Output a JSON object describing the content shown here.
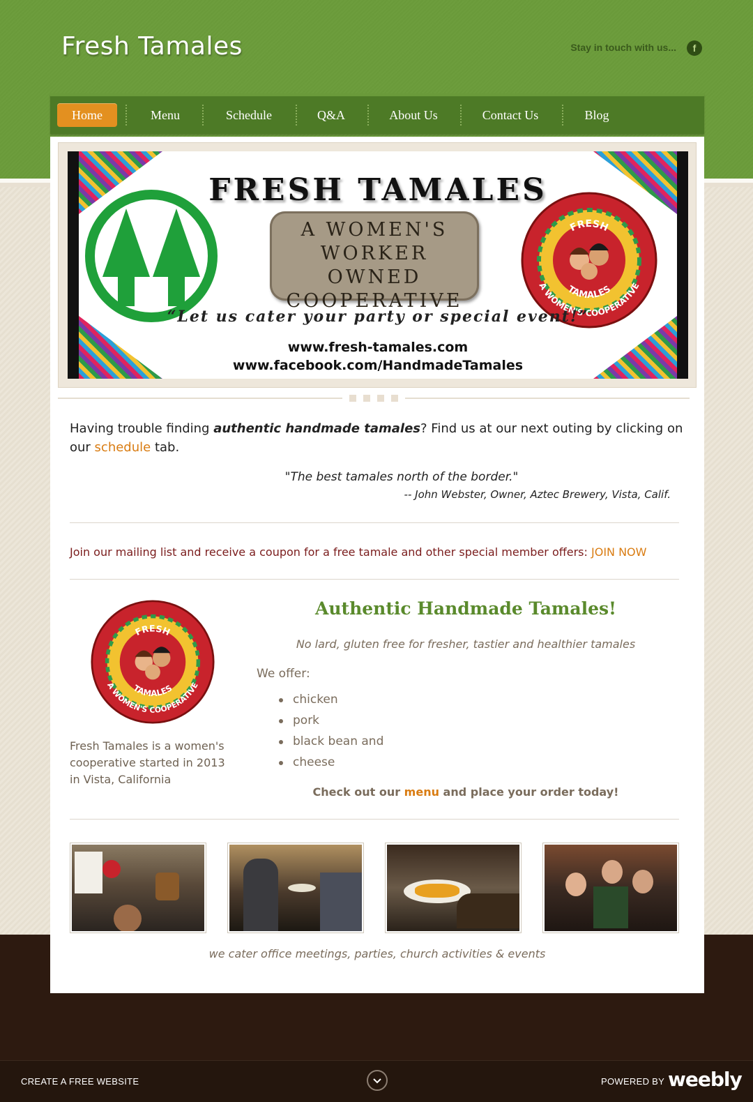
{
  "header": {
    "site_title": "Fresh Tamales",
    "social_text": "Stay in touch with us...",
    "social_icon": "facebook-icon",
    "social_glyph": "f"
  },
  "nav": {
    "items": [
      {
        "label": "Home",
        "active": true
      },
      {
        "label": "Menu"
      },
      {
        "label": "Schedule"
      },
      {
        "label": "Q&A"
      },
      {
        "label": "About Us"
      },
      {
        "label": "Contact Us"
      },
      {
        "label": "Blog"
      }
    ]
  },
  "banner": {
    "title": "FRESH TAMALES",
    "plaque_line1": "A WOMEN'S",
    "plaque_line2": "WORKER OWNED",
    "plaque_line3": "COOPERATIVE",
    "tagline": "“Let us cater your party or special event!”",
    "url1": "www.fresh-tamales.com",
    "url2": "www.facebook.com/HandmadeTamales",
    "logo_top": "FRESH",
    "logo_mid": "TAMALES",
    "logo_bottom": "A WOMEN'S COOPERATIVE"
  },
  "intro": {
    "before": "Having trouble finding ",
    "emphasis": "authentic handmade tamales",
    "middle": "?  Find us at our next outing by clicking on our ",
    "link": "schedule",
    "after": " tab."
  },
  "quote": {
    "text": "\"The best tamales north of the border.\"",
    "attribution": "-- John Webster, Owner, Aztec Brewery, Vista, Calif."
  },
  "mailing": {
    "text": "Join our mailing list and receive a coupon for a free tamale and other special member offers: ",
    "link": "JOIN NOW"
  },
  "about": {
    "description": "Fresh Tamales is a women's cooperative started in 2013 in Vista, California"
  },
  "offer": {
    "title": "Authentic Handmade Tamales!",
    "subtitle": "No lard, gluten free for fresher, tastier and healthier tamales",
    "label": "We offer:",
    "items": [
      "chicken",
      "pork",
      "black bean and",
      "cheese"
    ],
    "cta_before": "Check out our ",
    "cta_link": "menu",
    "cta_after": " and place your order today!"
  },
  "gallery": {
    "caption": "we cater office meetings, parties, church activities & events"
  },
  "footer": {
    "left": "CREATE A FREE WEBSITE",
    "right": "POWERED BY",
    "brand": "weebly"
  },
  "colors": {
    "header_green": "#6a9a3a",
    "nav_green": "#4d7a26",
    "nav_active": "#e39020",
    "link_orange": "#d97c12",
    "footer_brown": "#2d1a10"
  }
}
